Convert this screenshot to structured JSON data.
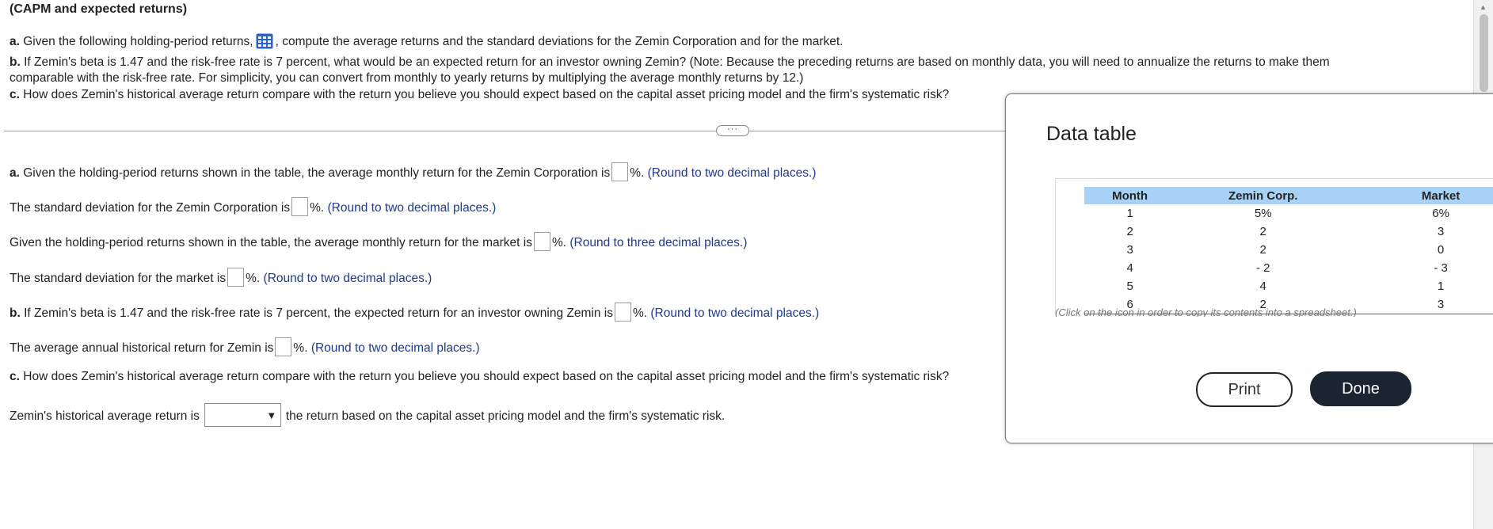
{
  "title": "(CAPM and expected returns)",
  "problem": {
    "a_label": "a.",
    "a_text_1": "Given the following holding-period returns,",
    "a_text_2": ", compute the average returns and the standard deviations for the Zemin Corporation and for the market.",
    "b_label": "b.",
    "b_text_1": "If Zemin's beta is 1.47 and the risk-free rate is 7 percent, what would be an expected return for an investor owning Zemin?  (Note: Because the preceding returns are based on monthly data, you will need to annualize the returns to make them",
    "b_text_2": "comparable with the risk-free rate.  For simplicity, you can convert from monthly to yearly returns by multiplying the average monthly returns by 12.)",
    "c_label": "c.",
    "c_text": "How does Zemin's historical average return compare with the return you believe you should expect based on the capital asset pricing model and the firm's systematic risk?"
  },
  "answers": {
    "a1_label": "a.",
    "a1_pre": "Given the holding-period returns shown in the table, the average monthly return for the Zemin Corporation is",
    "a1_post": "%.",
    "a1_hint": "(Round to two decimal places.)",
    "a2_pre": "The standard deviation for the Zemin Corporation is",
    "a2_post": "%.",
    "a2_hint": "(Round to two decimal places.)",
    "a3_pre": "Given the holding-period returns shown in the table, the average monthly return for the market is",
    "a3_post": "%.",
    "a3_hint": "(Round to three decimal places.)",
    "a4_pre": "The standard deviation for the market is",
    "a4_post": "%.",
    "a4_hint": "(Round to two decimal places.)",
    "b1_label": "b.",
    "b1_pre": "If Zemin's beta is 1.47 and the risk-free rate is 7 percent, the expected return for an investor owning Zemin is",
    "b1_post": "%.",
    "b1_hint": "(Round to two decimal places.)",
    "b2_pre": "The average annual historical return for Zemin is",
    "b2_post": "%.",
    "b2_hint": "(Round to two decimal places.)",
    "c1_label": "c.",
    "c1_text": "How does Zemin's historical average return compare with the return you believe you should expect based on the capital asset pricing model and the firm's systematic risk?",
    "c2_pre": "Zemin's historical average return is",
    "c2_post": "the return based on the capital asset pricing model and the firm's systematic risk.",
    "select_value": ""
  },
  "modal": {
    "title": "Data table",
    "headers": [
      "Month",
      "Zemin Corp.",
      "Market"
    ],
    "rows": [
      [
        "1",
        "5%",
        "6%"
      ],
      [
        "2",
        "2",
        "3"
      ],
      [
        "3",
        "2",
        "0"
      ],
      [
        "4",
        "- 2",
        "- 3"
      ],
      [
        "5",
        "4",
        "1"
      ],
      [
        "6",
        "2",
        "3"
      ]
    ],
    "footnote": "(Click on the icon  in order to copy its contents into a spreadsheet.)",
    "print_label": "Print",
    "done_label": "Done"
  },
  "icons": {
    "data-grid": "spreadsheet-icon",
    "dropdown": "caret-down-icon",
    "more": "ellipsis-icon"
  },
  "colors": {
    "hint_text": "#1f3a8a",
    "table_header": "#a8d2f5",
    "done_button": "#1b2431",
    "icon_blue": "#2b63c9"
  }
}
